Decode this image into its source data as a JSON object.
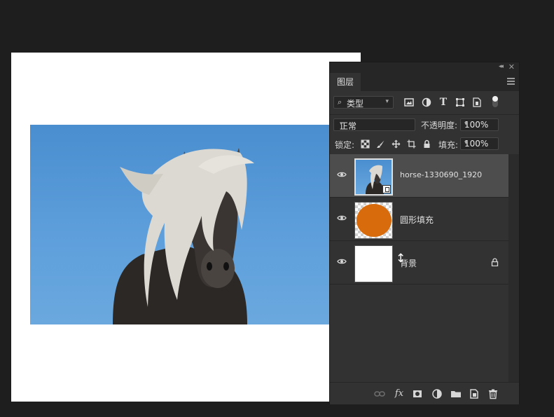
{
  "panel": {
    "tab": "图层",
    "filter": {
      "label": "类型",
      "search_glyph": "⌕"
    },
    "filter_icons": [
      "image-filter-icon",
      "adjustment-filter-icon",
      "type-filter-icon",
      "shape-filter-icon",
      "smart-object-filter-icon"
    ],
    "blend_mode": "正常",
    "opacity_label": "不透明度:",
    "opacity_value": "100%",
    "lock_label": "锁定:",
    "fill_label": "填充:",
    "fill_value": "100%"
  },
  "layers": [
    {
      "name": "horse-1330690_1920",
      "type": "smart-object",
      "selected": true
    },
    {
      "name": "圆形填充",
      "type": "shape"
    },
    {
      "name": "背景",
      "type": "background",
      "locked": true
    }
  ],
  "colors": {
    "accent_circle": "#d86b0c",
    "panel_bg": "#323232",
    "sky": "#5fa0dc"
  }
}
